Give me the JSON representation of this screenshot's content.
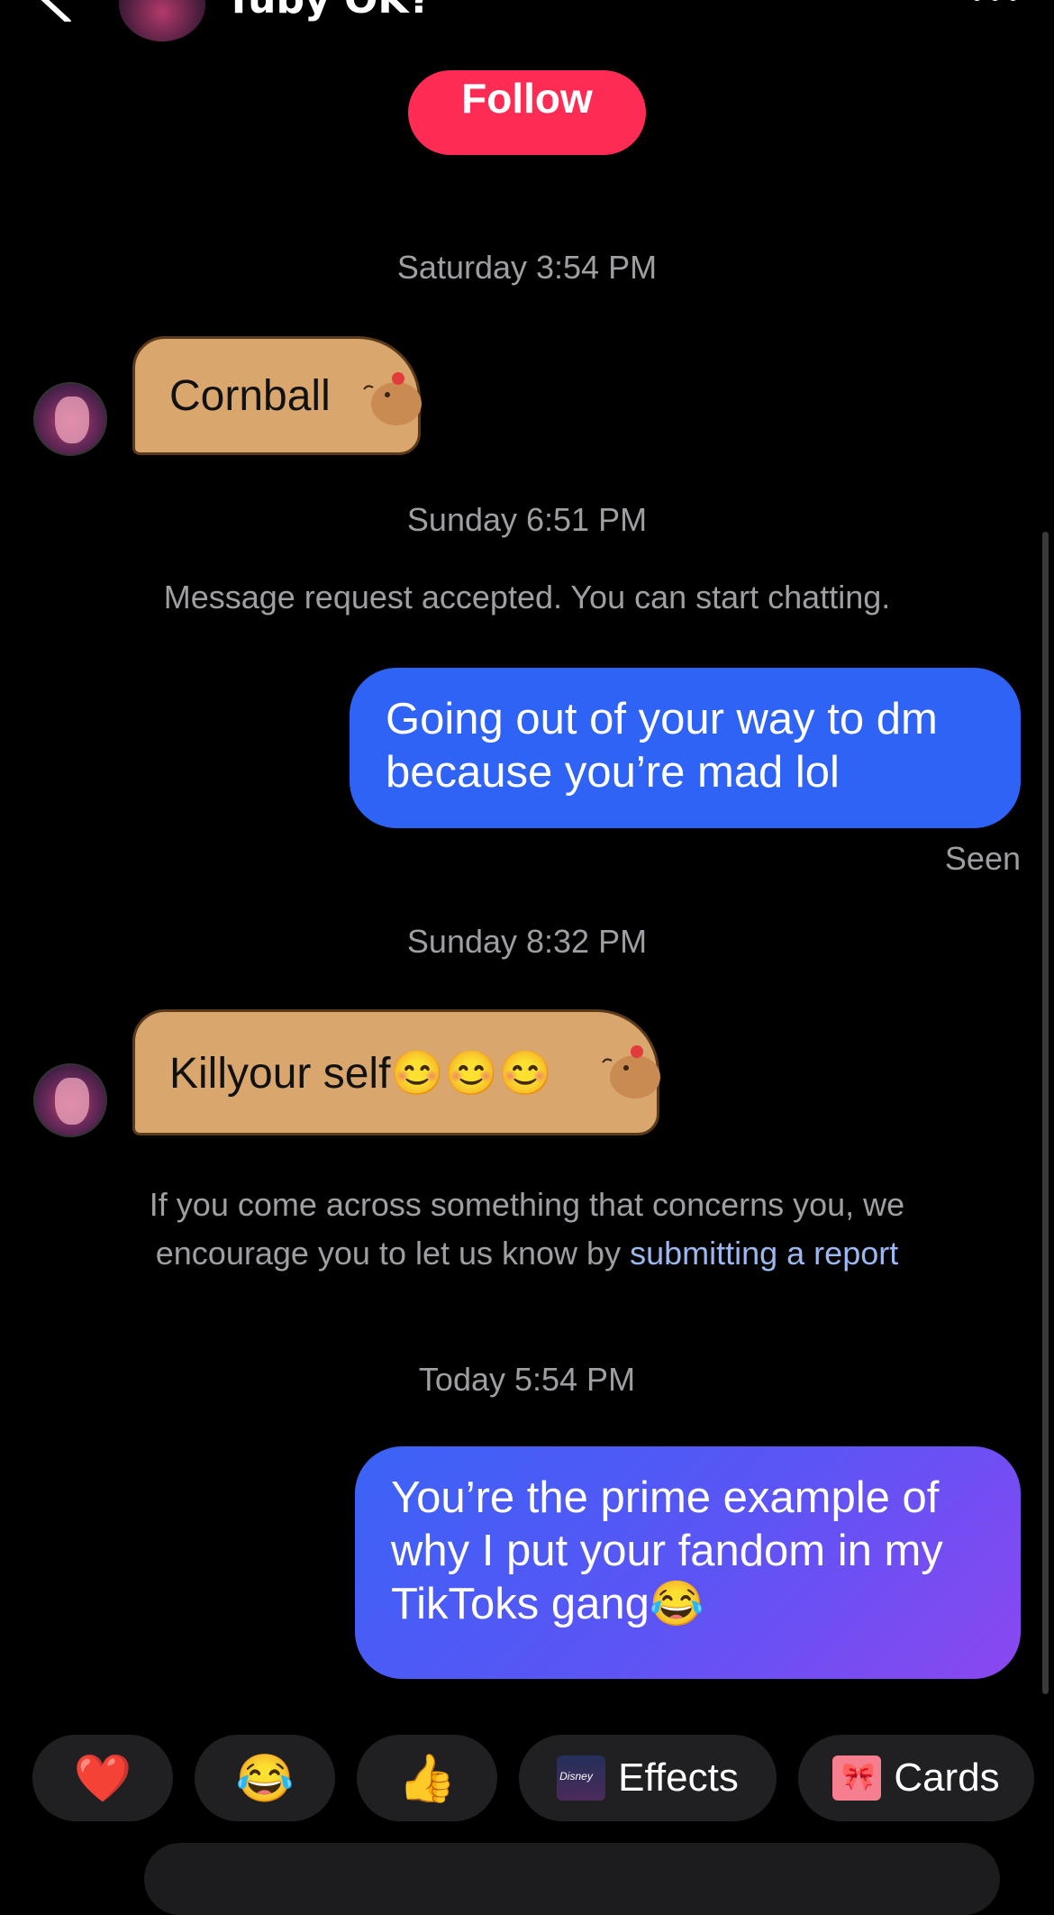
{
  "header": {
    "title": "Tuby OK?",
    "follow_label": "Follow"
  },
  "messages": {
    "ts1": "Saturday 3:54 PM",
    "m1": "Cornball",
    "ts2": "Sunday 6:51 PM",
    "system_accepted": "Message request accepted. You can start chatting.",
    "m2": "Going out of your way to dm because you’re mad lol",
    "seen": "Seen",
    "ts3": "Sunday 8:32 PM",
    "m3": "Killyour self😊😊😊",
    "system_report_prefix": "If you come across something that concerns you, we encourage you to let us know by ",
    "system_report_link": "submitting a report",
    "ts4": "Today 5:54 PM",
    "m4": "You’re the prime example of why I put your fandom in my TikToks gang😂"
  },
  "quick_actions": {
    "heart": "❤️",
    "laugh": "😂",
    "thumbs": "👍",
    "effects": "Effects",
    "cards": "Cards"
  },
  "colors": {
    "follow": "#fe2c55",
    "outgoing": "#2f63f5",
    "link": "#9cb8ee"
  }
}
